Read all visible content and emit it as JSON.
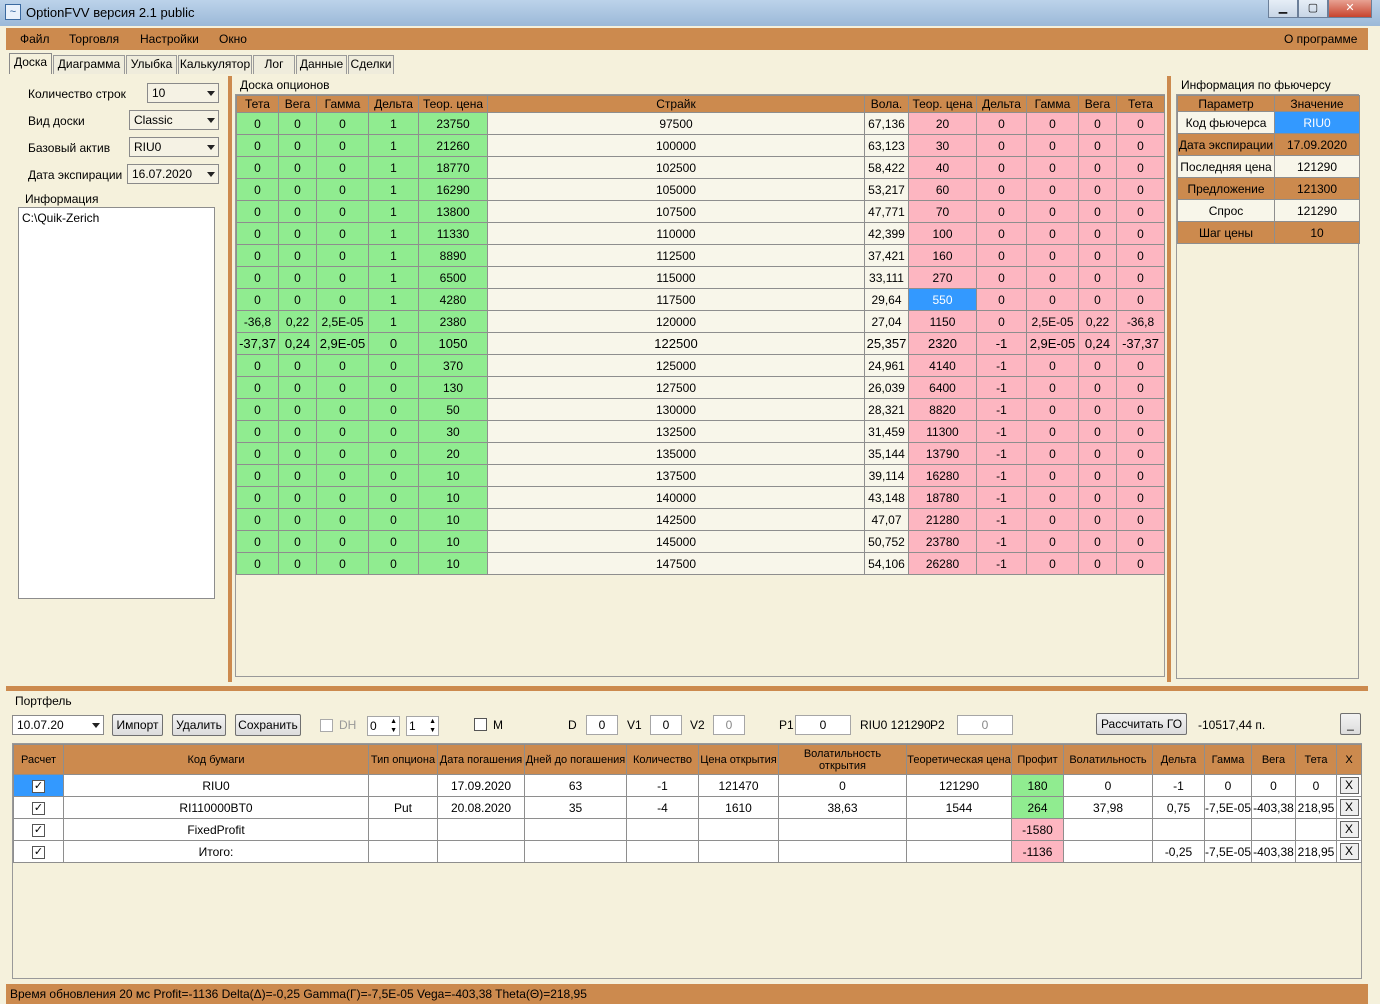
{
  "window": {
    "title": "OptionFVV версия 2.1 public"
  },
  "menu": {
    "file": "Файл",
    "trading": "Торговля",
    "settings": "Настройки",
    "window": "Окно",
    "about": "О программе"
  },
  "tabs": [
    "Доска",
    "Диаграмма",
    "Улыбка",
    "Калькулятор",
    "Лог",
    "Данные",
    "Сделки"
  ],
  "left": {
    "rows_label": "Количество строк",
    "rows_value": "10",
    "board_label": "Вид доски",
    "board_value": "Classic",
    "asset_label": "Базовый актив",
    "asset_value": "RIU0",
    "exp_label": "Дата экспирации",
    "exp_value": "16.07.2020",
    "info_label": "Информация",
    "info_text": "C:\\Quik-Zerich"
  },
  "board": {
    "title": "Доска опционов",
    "headers": [
      "Тета",
      "Вега",
      "Гамма",
      "Дельта",
      "Теор. цена",
      "Страйк",
      "Вола.",
      "Теор. цена",
      "Дельта",
      "Гамма",
      "Вега",
      "Тета"
    ],
    "rows": [
      [
        "0",
        "0",
        "0",
        "1",
        "23750",
        "97500",
        "67,136",
        "20",
        "0",
        "0",
        "0",
        "0"
      ],
      [
        "0",
        "0",
        "0",
        "1",
        "21260",
        "100000",
        "63,123",
        "30",
        "0",
        "0",
        "0",
        "0"
      ],
      [
        "0",
        "0",
        "0",
        "1",
        "18770",
        "102500",
        "58,422",
        "40",
        "0",
        "0",
        "0",
        "0"
      ],
      [
        "0",
        "0",
        "0",
        "1",
        "16290",
        "105000",
        "53,217",
        "60",
        "0",
        "0",
        "0",
        "0"
      ],
      [
        "0",
        "0",
        "0",
        "1",
        "13800",
        "107500",
        "47,771",
        "70",
        "0",
        "0",
        "0",
        "0"
      ],
      [
        "0",
        "0",
        "0",
        "1",
        "11330",
        "110000",
        "42,399",
        "100",
        "0",
        "0",
        "0",
        "0"
      ],
      [
        "0",
        "0",
        "0",
        "1",
        "8890",
        "112500",
        "37,421",
        "160",
        "0",
        "0",
        "0",
        "0"
      ],
      [
        "0",
        "0",
        "0",
        "1",
        "6500",
        "115000",
        "33,111",
        "270",
        "0",
        "0",
        "0",
        "0"
      ],
      [
        "0",
        "0",
        "0",
        "1",
        "4280",
        "117500",
        "29,64",
        "550",
        "0",
        "0",
        "0",
        "0"
      ],
      [
        "-36,8",
        "0,22",
        "2,5E-05",
        "1",
        "2380",
        "120000",
        "27,04",
        "1150",
        "0",
        "2,5E-05",
        "0,22",
        "-36,8"
      ],
      [
        "-37,37",
        "0,24",
        "2,9E-05",
        "0",
        "1050",
        "122500",
        "25,357",
        "2320",
        "-1",
        "2,9E-05",
        "0,24",
        "-37,37"
      ],
      [
        "0",
        "0",
        "0",
        "0",
        "370",
        "125000",
        "24,961",
        "4140",
        "-1",
        "0",
        "0",
        "0"
      ],
      [
        "0",
        "0",
        "0",
        "0",
        "130",
        "127500",
        "26,039",
        "6400",
        "-1",
        "0",
        "0",
        "0"
      ],
      [
        "0",
        "0",
        "0",
        "0",
        "50",
        "130000",
        "28,321",
        "8820",
        "-1",
        "0",
        "0",
        "0"
      ],
      [
        "0",
        "0",
        "0",
        "0",
        "30",
        "132500",
        "31,459",
        "11300",
        "-1",
        "0",
        "0",
        "0"
      ],
      [
        "0",
        "0",
        "0",
        "0",
        "20",
        "135000",
        "35,144",
        "13790",
        "-1",
        "0",
        "0",
        "0"
      ],
      [
        "0",
        "0",
        "0",
        "0",
        "10",
        "137500",
        "39,114",
        "16280",
        "-1",
        "0",
        "0",
        "0"
      ],
      [
        "0",
        "0",
        "0",
        "0",
        "10",
        "140000",
        "43,148",
        "18780",
        "-1",
        "0",
        "0",
        "0"
      ],
      [
        "0",
        "0",
        "0",
        "0",
        "10",
        "142500",
        "47,07",
        "21280",
        "-1",
        "0",
        "0",
        "0"
      ],
      [
        "0",
        "0",
        "0",
        "0",
        "10",
        "145000",
        "50,752",
        "23780",
        "-1",
        "0",
        "0",
        "0"
      ],
      [
        "0",
        "0",
        "0",
        "0",
        "10",
        "147500",
        "54,106",
        "26280",
        "-1",
        "0",
        "0",
        "0"
      ]
    ],
    "selected_cell": {
      "row": 8,
      "col": 7
    },
    "bold_row": 10
  },
  "future": {
    "title": "Информация по фьючерсу",
    "headers": [
      "Параметр",
      "Значение"
    ],
    "rows": [
      [
        "Код фьючерса",
        "RIU0"
      ],
      [
        "Дата экспирации",
        "17.09.2020"
      ],
      [
        "Последняя цена",
        "121290"
      ],
      [
        "Предложение",
        "121300"
      ],
      [
        "Спрос",
        "121290"
      ],
      [
        "Шаг цены",
        "10"
      ]
    ]
  },
  "portfolio": {
    "title": "Портфель",
    "date": "10.07.20",
    "import": "Импорт",
    "delete": "Удалить",
    "save": "Сохранить",
    "dh": "DH",
    "spin1": "0",
    "spin2": "1",
    "m": "M",
    "d_label": "D",
    "d_value": "0",
    "v1_label": "V1",
    "v1_value": "0",
    "v2_label": "V2",
    "v2_value": "0",
    "p1_label": "P1",
    "p1_value": "0",
    "riu_label": "RIU0 121290",
    "p2_label": "P2",
    "p2_value": "0",
    "calc_go": "Рассчитать ГО",
    "go_value": "-10517,44 п.",
    "min_btn": "_",
    "headers": [
      "Расчет",
      "Код бумаги",
      "Тип опциона",
      "Дата погашения",
      "Дней до погашения",
      "Количество",
      "Цена открытия",
      "Волатильность открытия",
      "Теоретическая цена",
      "Профит",
      "Волатильность",
      "Дельта",
      "Гамма",
      "Вега",
      "Тета",
      "X"
    ],
    "rows": [
      [
        "RIU0",
        "",
        "17.09.2020",
        "63",
        "-1",
        "121470",
        "0",
        "121290",
        "180",
        "0",
        "-1",
        "0",
        "0",
        "0"
      ],
      [
        "RI110000BT0",
        "Put",
        "20.08.2020",
        "35",
        "-4",
        "1610",
        "38,63",
        "1544",
        "264",
        "37,98",
        "0,75",
        "-7,5E-05",
        "-403,38",
        "218,95"
      ],
      [
        "FixedProfit",
        "",
        "",
        "",
        "",
        "",
        "",
        "",
        "-1580",
        "",
        "",
        "",
        "",
        ""
      ],
      [
        "Итого:",
        "",
        "",
        "",
        "",
        "",
        "",
        "",
        "-1136",
        "",
        "-0,25",
        "-7,5E-05",
        "-403,38",
        "218,95"
      ]
    ]
  },
  "status": {
    "text": "Время обновления 20 мс  Profit=-1136 Delta(Δ)=-0,25 Gamma(Γ)=-7,5E-05 Vega=-403,38 Theta(Θ)=218,95"
  },
  "colors": {
    "accent": "#cc8a4e",
    "green": "#90ec90",
    "pink": "#fdb6c1",
    "selected": "#3399ff"
  }
}
